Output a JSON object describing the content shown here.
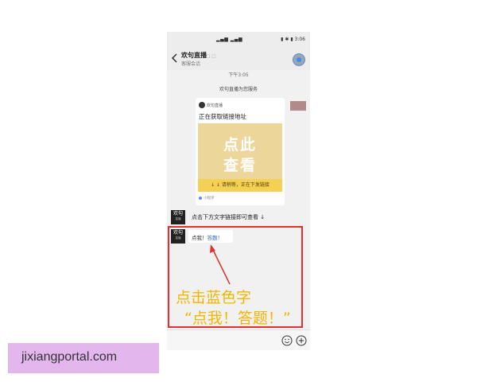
{
  "status_bar": {
    "left": "▂▄▆ ▂▄▆",
    "right": "▮ ✱ ▮ 3:06"
  },
  "header": {
    "title": "欢句直播",
    "subtitle": "客服会话",
    "extra": "☐ ☐"
  },
  "chat": {
    "timestamp": "下午3:05",
    "service_note": "欢句直播为您服务",
    "card": {
      "source": "欢句直播",
      "title": "正在获取链接地址",
      "image_line1": "点此",
      "image_line2": "查看",
      "image_bottom": "↓ ↓ 请稍等，正在下发链接",
      "footer": "小程序"
    },
    "msg1_avatar": "欢句",
    "msg1_avatar_small": "直播",
    "msg1_text": "点击下方文字链接即可查看 ↓",
    "msg2_avatar": "欢句",
    "msg2_avatar_small": "直播",
    "bubble_prefix": "点我！",
    "bubble_link": "答题！"
  },
  "annotation": {
    "line1": "点击蓝色字",
    "line2": "“点我！答题！”"
  },
  "watermark": "jixiangportal.com",
  "colors": {
    "highlight": "#e03030",
    "caption": "#f2b600",
    "link": "#2e64c8",
    "watermark_bg": "#e3b7ee"
  }
}
